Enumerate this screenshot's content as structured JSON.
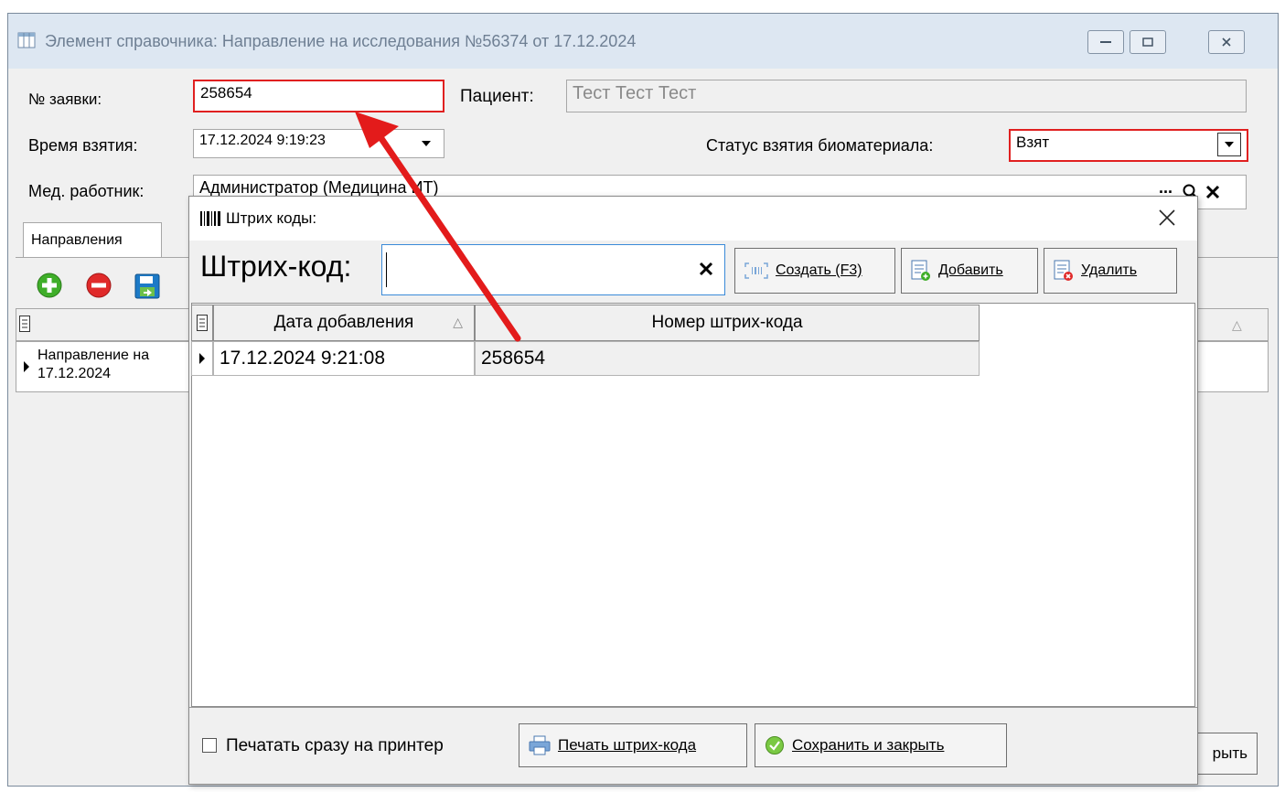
{
  "main_window": {
    "title": "Элемент справочника: Направление на исследования №56374 от 17.12.2024",
    "order_no_label": "№ заявки:",
    "order_no_value": "258654",
    "patient_label": "Пациент:",
    "patient_value": "Тест Тест Тест",
    "collect_time_label": "Время взятия:",
    "collect_time_value": "17.12.2024 9:19:23",
    "biomaterial_status_label": "Статус взятия биоматериала:",
    "biomaterial_status_value": "Взят",
    "medic_label": "Мед. работник:",
    "medic_value": "Администратор (Медицина ИТ)",
    "medic_more": "...",
    "tab_label": "Направления",
    "grid_row_line1": "Направление на",
    "grid_row_line2": "17.12.2024",
    "close_button_partial": "рыть"
  },
  "dialog": {
    "title": "Штрих коды:",
    "barcode_label": "Штрих-код:",
    "barcode_value": "",
    "create_button": "Создать (F3)",
    "add_button": "Добавить",
    "delete_button": "Удалить",
    "table": {
      "columns": [
        "Дата добавления",
        "Номер штрих-кода"
      ],
      "rows": [
        {
          "date": "17.12.2024 9:21:08",
          "barcode": "258654"
        }
      ]
    },
    "print_now_label": "Печатать сразу на принтер",
    "print_now_checked": false,
    "print_button": "Печать штрих-кода",
    "save_close_button": "Сохранить и закрыть"
  },
  "colors": {
    "highlight_red": "#e02020",
    "arrow_red": "#e31b1b",
    "title_bar": "#dde7f2"
  }
}
